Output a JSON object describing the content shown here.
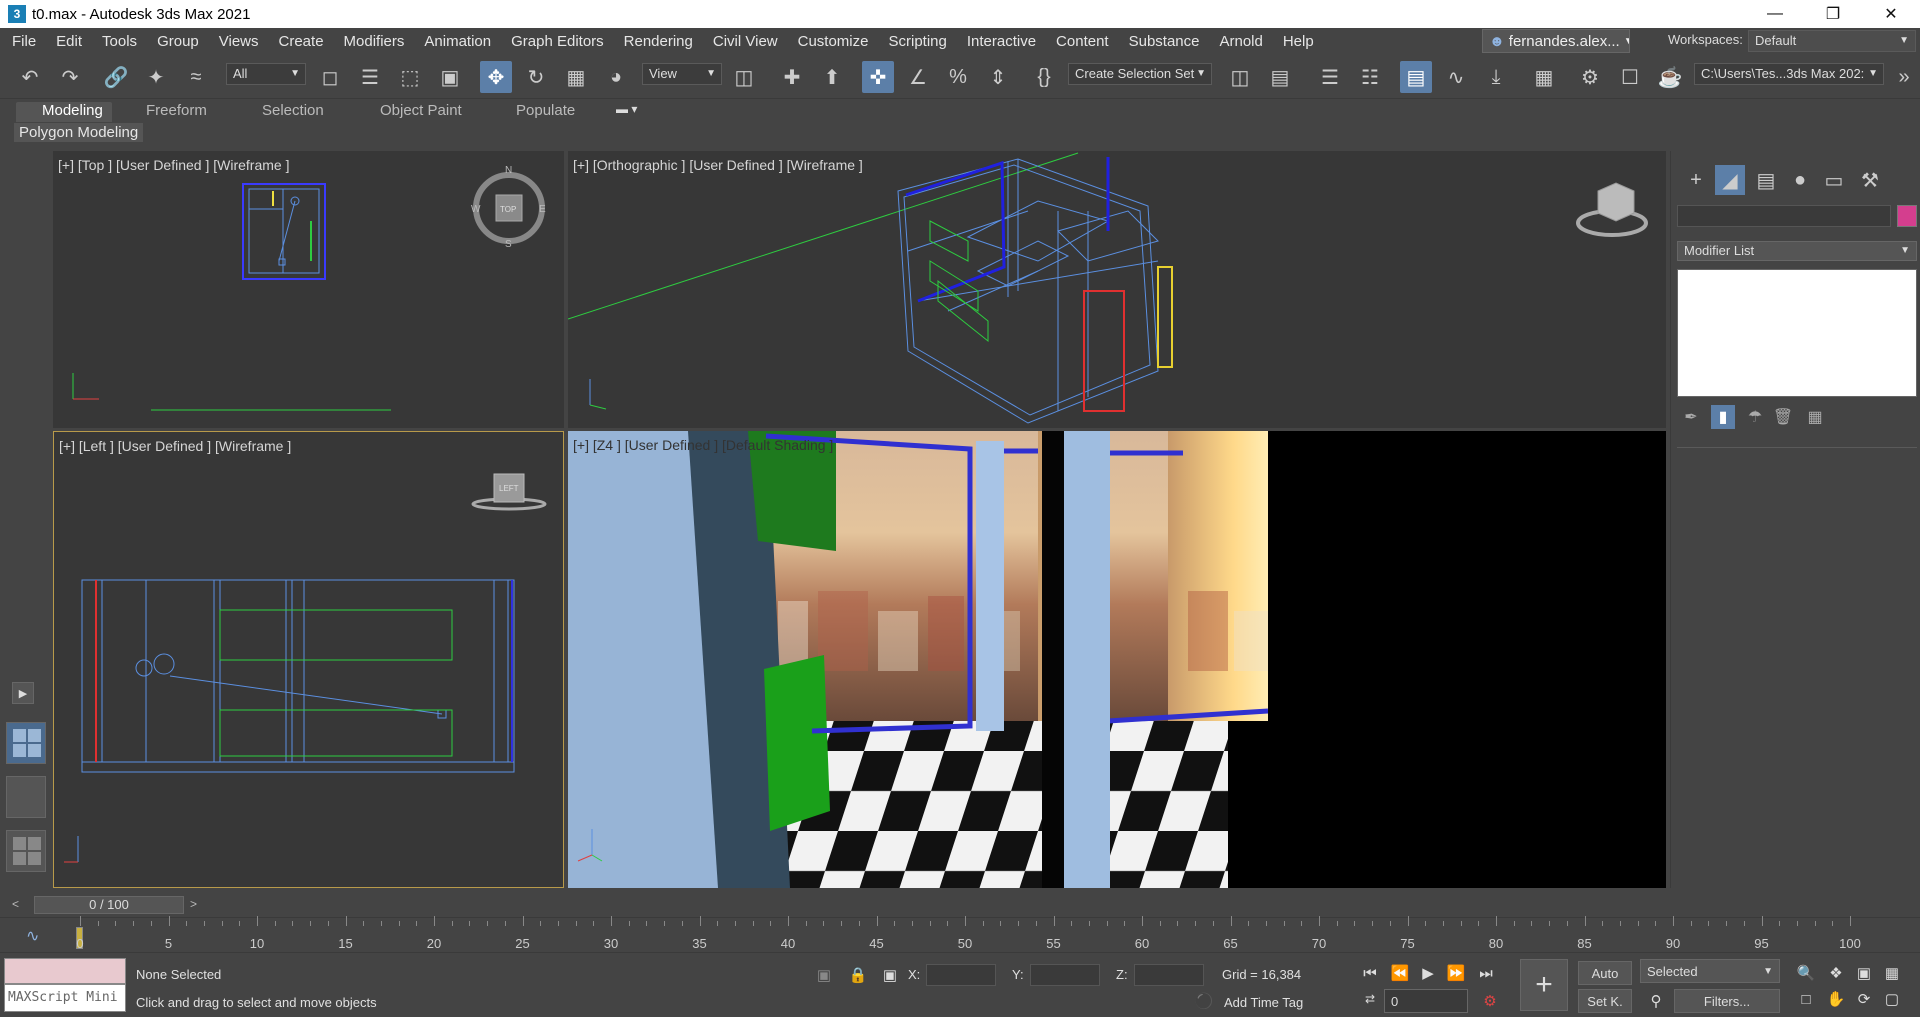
{
  "window": {
    "title": "t0.max - Autodesk 3ds Max 2021",
    "app_icon": "3",
    "controls": [
      "—",
      "❐",
      "✕"
    ]
  },
  "menu": [
    "File",
    "Edit",
    "Tools",
    "Group",
    "Views",
    "Create",
    "Modifiers",
    "Animation",
    "Graph Editors",
    "Rendering",
    "Civil View",
    "Customize",
    "Scripting",
    "Interactive",
    "Content",
    "Substance",
    "Arnold",
    "Help"
  ],
  "user": {
    "name": "fernandes.alex...",
    "icon": "user-icon"
  },
  "workspace": {
    "label": "Workspaces:",
    "value": "Default"
  },
  "toolbar": {
    "selection_filter": "All",
    "ref_coord": "View",
    "named_selection": "Create Selection Set",
    "project_path": "C:\\Users\\Tes...3ds Max 202:"
  },
  "ribbon": {
    "tabs": [
      "Modeling",
      "Freeform",
      "Selection",
      "Object Paint",
      "Populate"
    ],
    "active_tab": "Modeling",
    "panel": "Polygon Modeling"
  },
  "viewports": {
    "top": {
      "label": "[+] [Top ] [User Defined ] [Wireframe ]",
      "cube_label": "TOP",
      "compass": [
        "N",
        "E",
        "S",
        "W"
      ]
    },
    "ortho": {
      "label": "[+] [Orthographic ] [User Defined ] [Wireframe ]"
    },
    "left": {
      "label": "[+] [Left ] [User Defined ] [Wireframe ]",
      "cube_label": "LEFT"
    },
    "persp": {
      "label": "[+] [Z4 ] [User Defined ] [Default Shading ]"
    },
    "axes": {
      "x": "x",
      "y": "y",
      "z": "z"
    }
  },
  "command_panel": {
    "modifier_list": "Modifier List"
  },
  "timeline": {
    "frame": "0 / 100",
    "prev": "<",
    "next": ">",
    "ticks": [
      0,
      5,
      10,
      15,
      20,
      25,
      30,
      35,
      40,
      45,
      50,
      55,
      60,
      65,
      70,
      75,
      80,
      85,
      90,
      95,
      100
    ]
  },
  "status": {
    "maxscript": "MAXScript Mini",
    "selection": "None Selected",
    "prompt": "Click and drag to select and move objects",
    "x_label": "X:",
    "y_label": "Y:",
    "z_label": "Z:",
    "grid": "Grid = 16,384",
    "add_time_tag": "Add Time Tag",
    "auto": "Auto",
    "set_key": "Set K.",
    "key_filter": "Selected",
    "filters": "Filters...",
    "current_frame": "0"
  }
}
